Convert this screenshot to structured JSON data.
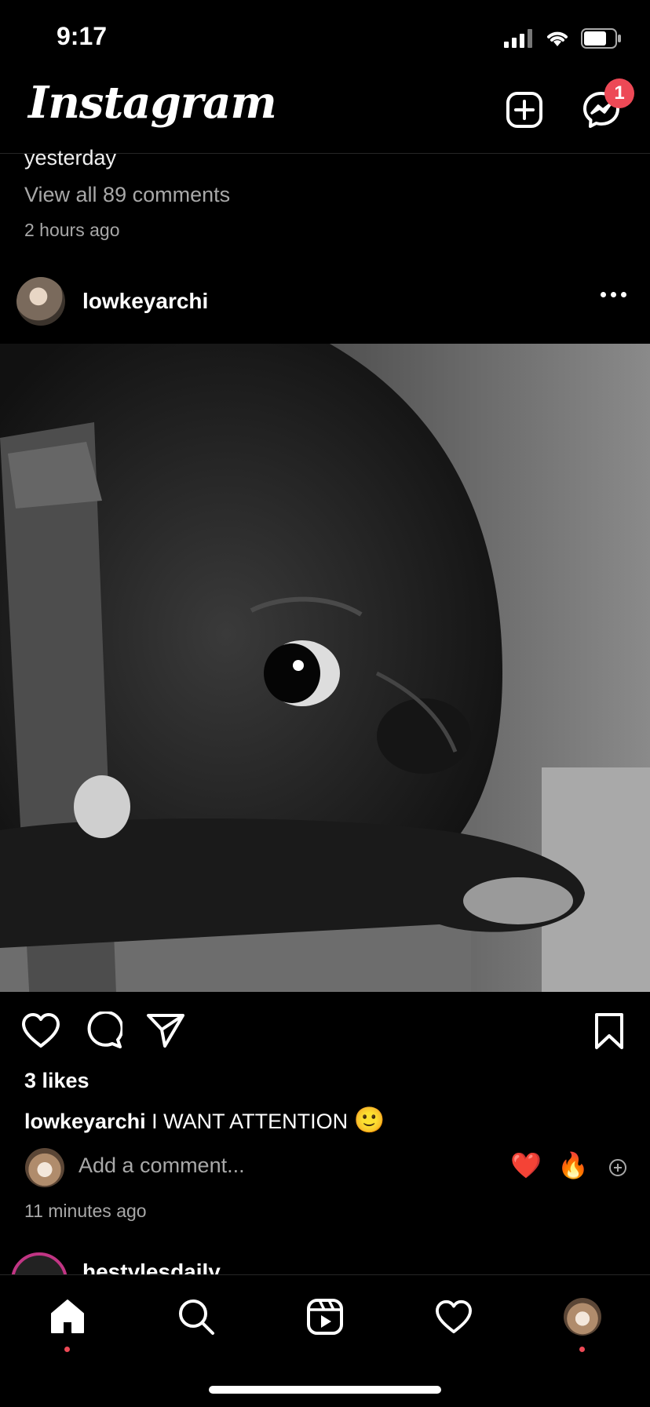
{
  "status_bar": {
    "time": "9:17"
  },
  "header": {
    "logo": "Instagram",
    "messages_badge": "1"
  },
  "previous_post": {
    "partial_text": "yesterday",
    "view_all_comments": "View all 89 comments",
    "timestamp": "2 hours ago"
  },
  "post": {
    "username": "lowkeyarchi",
    "likes": "3 likes",
    "caption_user": "lowkeyarchi",
    "caption_text": "I WANT ATTENTION",
    "caption_emoji": "🙂",
    "comment_placeholder": "Add a comment...",
    "quick_reactions": [
      "❤️",
      "🔥"
    ],
    "timestamp": "11 minutes ago"
  },
  "next_post": {
    "username": "hestylesdaily"
  },
  "tabs": [
    "home",
    "search",
    "reels",
    "activity",
    "profile"
  ],
  "colors": {
    "background": "#000000",
    "badge": "#ed4956",
    "secondary_text": "#a8a8a8"
  },
  "icons": [
    "cellular-icon",
    "wifi-icon",
    "battery-icon",
    "new-post-icon",
    "messenger-icon",
    "more-icon",
    "heart-icon",
    "comment-icon",
    "share-icon",
    "bookmark-icon",
    "add-reaction-icon",
    "home-icon",
    "search-icon",
    "reels-icon",
    "activity-icon"
  ]
}
